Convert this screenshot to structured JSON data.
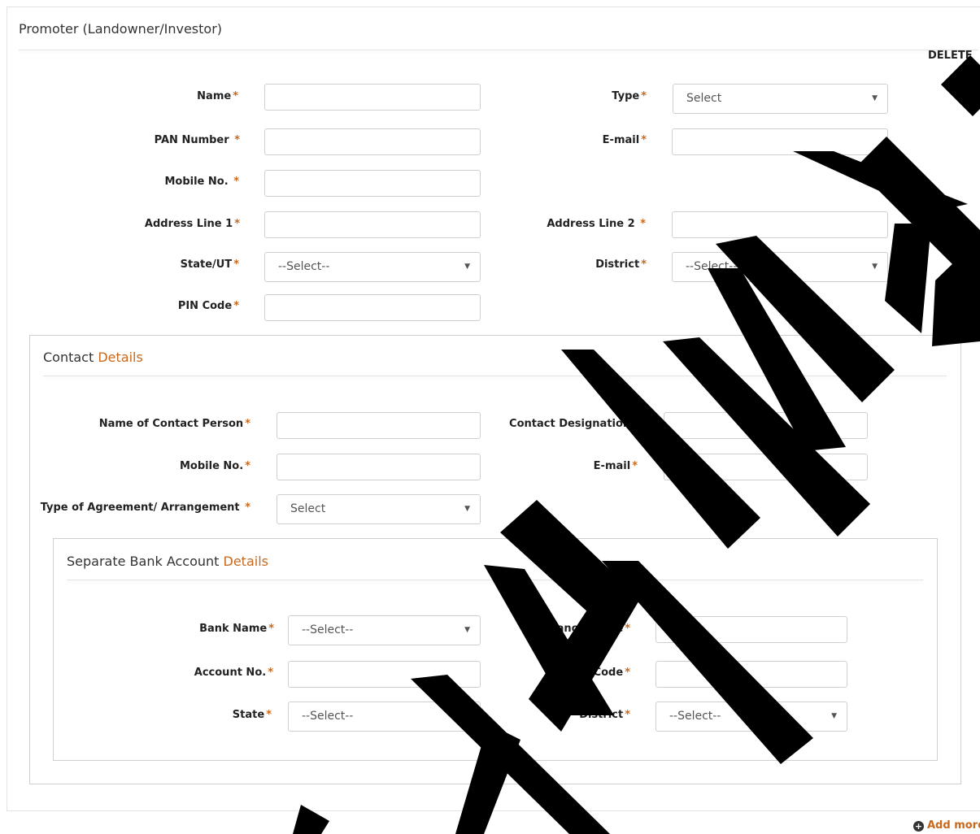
{
  "promoter": {
    "title": "Promoter (Landowner/Investor)",
    "delete_label": "DELETE",
    "fields": {
      "name": "Name",
      "type": "Type",
      "type_value": "Select",
      "pan": "PAN Number ",
      "email": "E-mail",
      "mobile": "Mobile No. ",
      "addr1": "Address Line 1",
      "addr2": "Address Line 2 ",
      "state": "State/UT",
      "state_value": "--Select--",
      "district": "District",
      "district_value": "--Select--",
      "pin": "PIN Code"
    }
  },
  "contact": {
    "title_main": "Contact ",
    "title_accent": "Details",
    "fields": {
      "person": "Name of Contact Person",
      "designation": "Contact Designation",
      "mobile": "Mobile No.",
      "email": "E-mail",
      "agreement": "Type of Agreement/ Arrangement ",
      "agreement_value": "Select"
    }
  },
  "bank": {
    "title_main": "Separate Bank Account ",
    "title_accent": "Details",
    "fields": {
      "bank_name": "Bank Name",
      "bank_name_value": "--Select--",
      "branch": "Branch Name",
      "account": "Account No.",
      "ifsc": "IFSC Code",
      "state": "State",
      "state_value": "--Select--",
      "district": "District",
      "district_value": "--Select--"
    }
  },
  "star": "*",
  "arrow": "▼",
  "add_more": "Add more",
  "add_more_icon": "+",
  "watermark_text": "MANUAL",
  "colors": {
    "accent": "#c8691d",
    "watermark": "#000000"
  }
}
